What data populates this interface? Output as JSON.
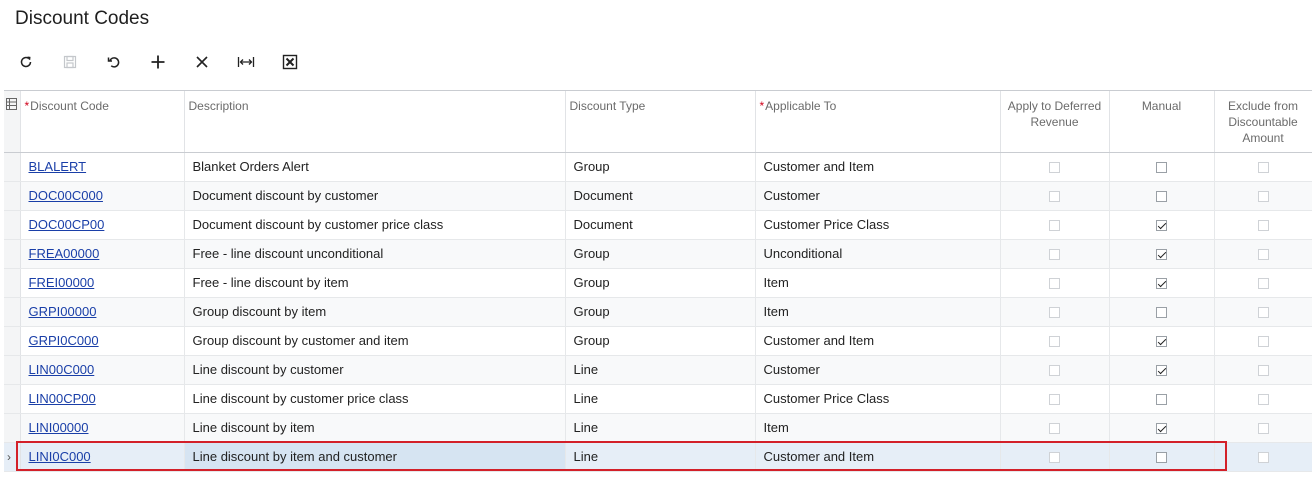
{
  "page": {
    "title": "Discount Codes"
  },
  "toolbar": [
    {
      "name": "refresh-button",
      "icon": "refresh-icon"
    },
    {
      "name": "save-button",
      "icon": "save-icon"
    },
    {
      "name": "undo-button",
      "icon": "undo-icon"
    },
    {
      "name": "add-row-button",
      "icon": "plus-icon"
    },
    {
      "name": "delete-row-button",
      "icon": "close-icon"
    },
    {
      "name": "fit-columns-button",
      "icon": "fit-width-icon"
    },
    {
      "name": "export-excel-button",
      "icon": "excel-icon"
    }
  ],
  "columns": {
    "discount_code": "Discount Code",
    "description": "Description",
    "discount_type": "Discount Type",
    "applicable_to": "Applicable To",
    "apply_to_deferred": "Apply to Deferred Revenue",
    "manual": "Manual",
    "exclude_discountable": "Exclude from Discountable Amount"
  },
  "rows": [
    {
      "code": "BLALERT",
      "description": "Blanket Orders Alert",
      "type": "Group",
      "applicable": "Customer and Item",
      "deferred": false,
      "manual": false,
      "exclude": false
    },
    {
      "code": "DOC00C000",
      "description": "Document discount by customer",
      "type": "Document",
      "applicable": "Customer",
      "deferred": false,
      "manual": false,
      "exclude": false
    },
    {
      "code": "DOC00CP00",
      "description": "Document discount by customer price class",
      "type": "Document",
      "applicable": "Customer Price Class",
      "deferred": false,
      "manual": true,
      "exclude": false
    },
    {
      "code": "FREA00000",
      "description": "Free - line discount unconditional",
      "type": "Group",
      "applicable": "Unconditional",
      "deferred": false,
      "manual": true,
      "exclude": false
    },
    {
      "code": "FREI00000",
      "description": "Free - line discount by item",
      "type": "Group",
      "applicable": "Item",
      "deferred": false,
      "manual": true,
      "exclude": false
    },
    {
      "code": "GRPI00000",
      "description": "Group discount by item",
      "type": "Group",
      "applicable": "Item",
      "deferred": false,
      "manual": false,
      "exclude": false
    },
    {
      "code": "GRPI0C000",
      "description": "Group discount by customer and item",
      "type": "Group",
      "applicable": "Customer and Item",
      "deferred": false,
      "manual": true,
      "exclude": false
    },
    {
      "code": "LIN00C000",
      "description": "Line discount by customer",
      "type": "Line",
      "applicable": "Customer",
      "deferred": false,
      "manual": true,
      "exclude": false
    },
    {
      "code": "LIN00CP00",
      "description": "Line discount by customer price class",
      "type": "Line",
      "applicable": "Customer Price Class",
      "deferred": false,
      "manual": false,
      "exclude": false
    },
    {
      "code": "LINI00000",
      "description": "Line discount by item",
      "type": "Line",
      "applicable": "Item",
      "deferred": false,
      "manual": true,
      "exclude": false
    },
    {
      "code": "LINI0C000",
      "description": "Line discount by item and customer",
      "type": "Line",
      "applicable": "Customer and Item",
      "deferred": false,
      "manual": false,
      "exclude": false,
      "active": true
    }
  ],
  "colors": {
    "link": "#1a3fa8",
    "highlight": "#d32029",
    "required": "#d0021b"
  }
}
